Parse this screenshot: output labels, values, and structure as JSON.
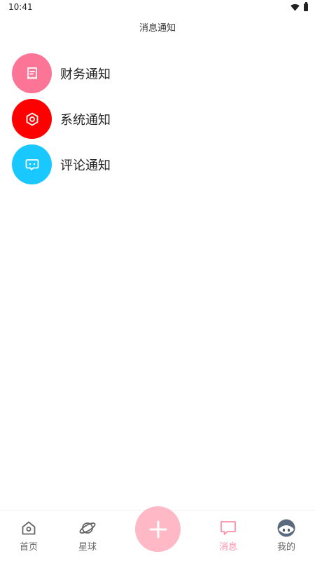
{
  "status_bar": {
    "time": "10:41"
  },
  "header": {
    "title": "消息通知"
  },
  "notifications": [
    {
      "label": "财务通知",
      "icon": "receipt-icon",
      "color": "#fd7596"
    },
    {
      "label": "系统通知",
      "icon": "hexagon-settings-icon",
      "color": "#ff0000"
    },
    {
      "label": "评论通知",
      "icon": "chat-bubble-icon",
      "color": "#18c8ff"
    }
  ],
  "tab_bar": {
    "home": "首页",
    "planet": "星球",
    "messages": "消息",
    "mine": "我的",
    "active": "messages",
    "active_color": "#ff8fa8",
    "add_button_color": "#ffb8c5"
  }
}
